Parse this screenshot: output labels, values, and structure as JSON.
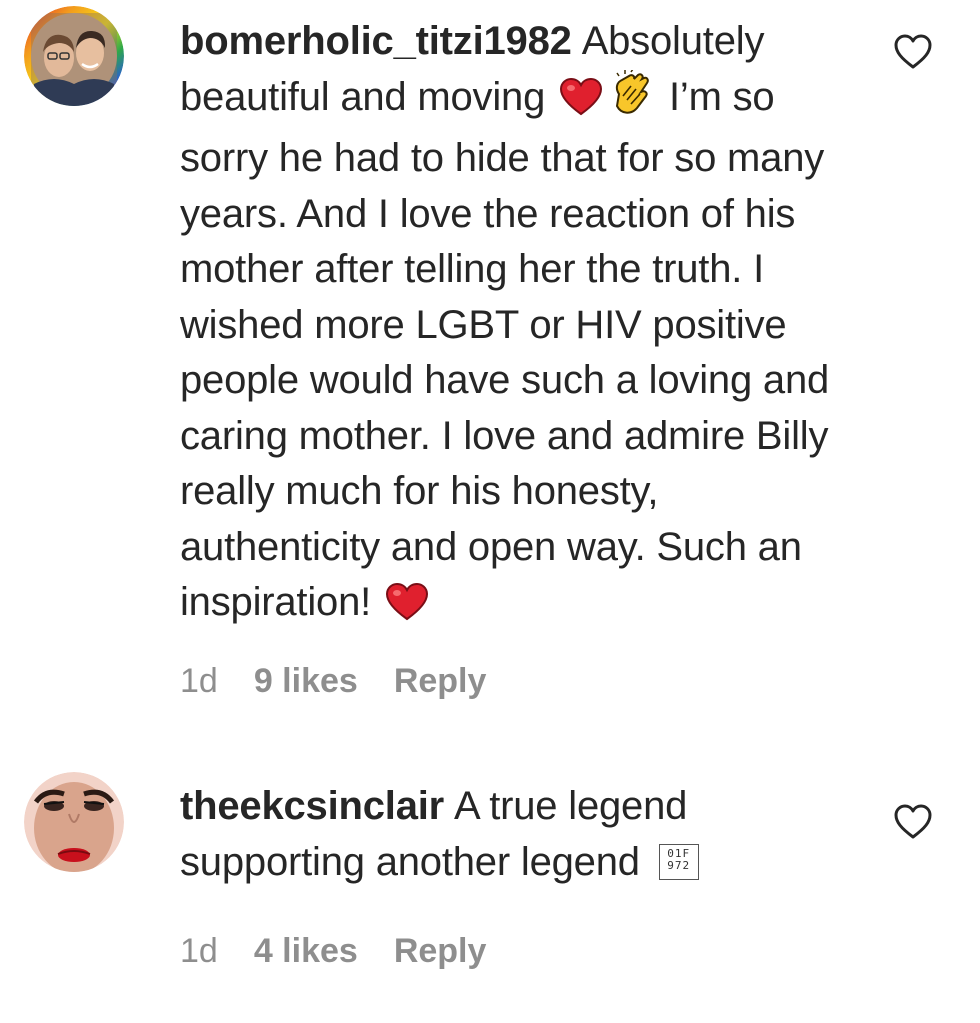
{
  "comments": [
    {
      "username": "bomerholic_titzi1982",
      "text_1": "Absolutely beautiful and moving",
      "emoji_1": "red-heart-icon",
      "emoji_2": "clapping-hands-icon",
      "text_2": "I’m so sorry he had to hide that for so many years. And I love the reaction of his mother after telling her the truth. I wished more LGBT or HIV positive people would have such a loving and caring mother. I love and admire Billy really much for his honesty, authenticity and open way. Such an inspiration!",
      "emoji_3": "red-heart-icon",
      "time": "1d",
      "likes": "9 likes",
      "reply_label": "Reply"
    },
    {
      "username": "theekcsinclair",
      "text_1": "A true legend supporting another legend",
      "unknown_glyph": "01F 972",
      "time": "1d",
      "likes": "4 likes",
      "reply_label": "Reply"
    }
  ],
  "colors": {
    "text": "#262626",
    "meta": "#8e8e8e",
    "heart": "#e0202e"
  }
}
